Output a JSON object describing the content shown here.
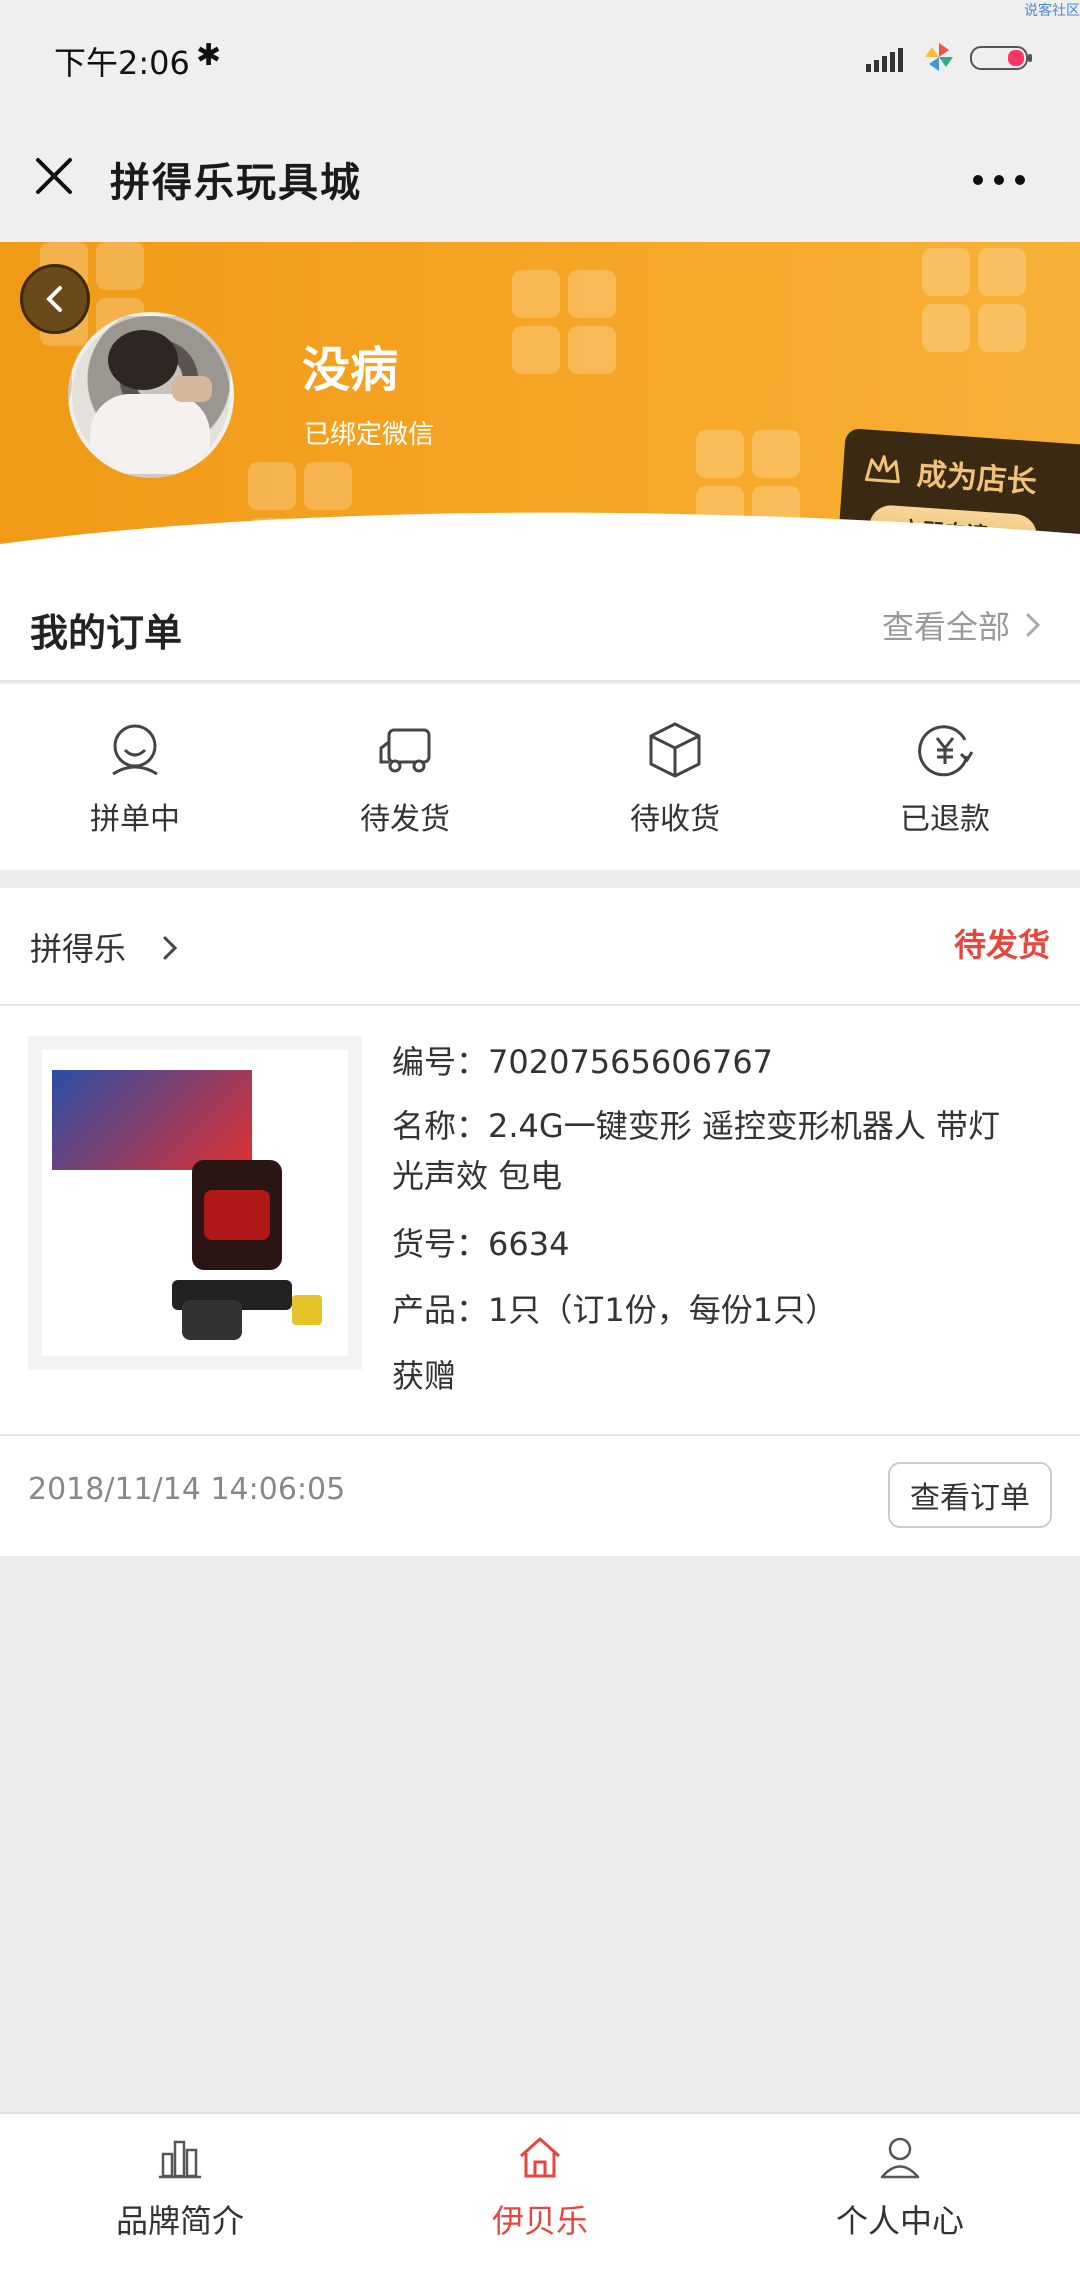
{
  "status_bar": {
    "time": "下午2:06",
    "watermark": "说客社区"
  },
  "header": {
    "title": "拼得乐玩具城"
  },
  "profile": {
    "name": "没病",
    "bind_status": "已绑定微信",
    "promo_title": "成为店长",
    "promo_button": "立即申请>"
  },
  "orders": {
    "title": "我的订单",
    "view_all": "查看全部",
    "statuses": [
      {
        "label": "拼单中",
        "icon": "group-smile-icon"
      },
      {
        "label": "待发货",
        "icon": "truck-icon"
      },
      {
        "label": "待收货",
        "icon": "box-icon"
      },
      {
        "label": "已退款",
        "icon": "yen-refund-icon"
      }
    ]
  },
  "order_card": {
    "shop_name": "拼得乐",
    "state": "待发货",
    "number": "编号：70207565606767",
    "name_line1": "名称：2.4G一键变形 遥控变形机器人 带灯",
    "name_line2": "光声效 包电",
    "sku": "货号：6634",
    "product": "产品：1只（订1份，每份1只）",
    "gift": "获赠",
    "time": "2018/11/14 14:06:05",
    "view_order": "查看订单"
  },
  "bottom_nav": {
    "items": [
      {
        "label": "品牌简介",
        "icon": "bar-chart-icon",
        "active": false
      },
      {
        "label": "伊贝乐",
        "icon": "home-icon",
        "active": true
      },
      {
        "label": "个人中心",
        "icon": "person-icon",
        "active": false
      }
    ]
  },
  "colors": {
    "brand_orange": "#f6a524",
    "accent_red": "#e8453c"
  }
}
